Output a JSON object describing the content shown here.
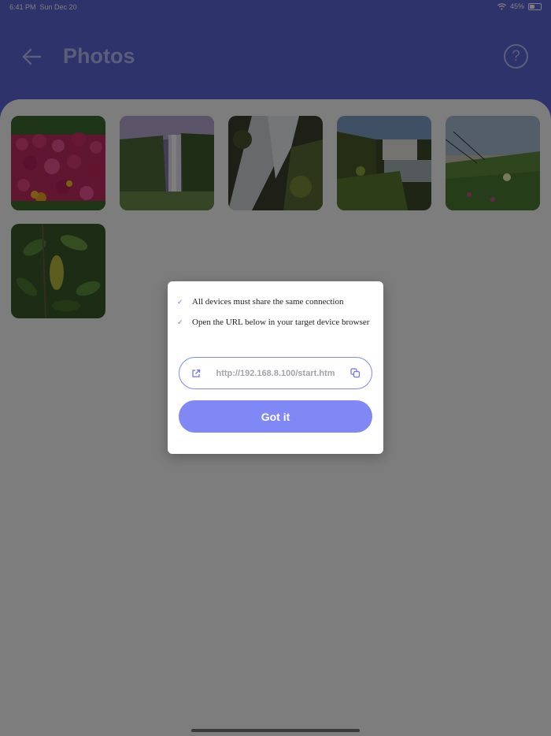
{
  "status_bar": {
    "time": "6:41 PM",
    "date": "Sun Dec 20",
    "battery_percent": "45%",
    "battery_level": 0.45
  },
  "header": {
    "title": "Photos",
    "back_icon": "arrow-left-icon",
    "help_icon": "question-circle-icon",
    "help_glyph": "?"
  },
  "photos": [
    {
      "subject": "flowers"
    },
    {
      "subject": "waterfall"
    },
    {
      "subject": "waterfall"
    },
    {
      "subject": "waterfall"
    },
    {
      "subject": "coastal meadow"
    },
    {
      "subject": "leaves"
    }
  ],
  "dialog": {
    "checklist": [
      {
        "check": "✓",
        "text": "All devices must share the same connection"
      },
      {
        "check": "✓",
        "text": "Open the URL below in your target device browser"
      }
    ],
    "url": "http://192.168.8.100/start.htm",
    "open_link_icon": "external-link-icon",
    "copy_icon": "copy-icon",
    "button_label": "Got it"
  },
  "colors": {
    "header": "#5c66d6",
    "accent": "#7f88f4",
    "title_text": "#b7bcf0"
  }
}
